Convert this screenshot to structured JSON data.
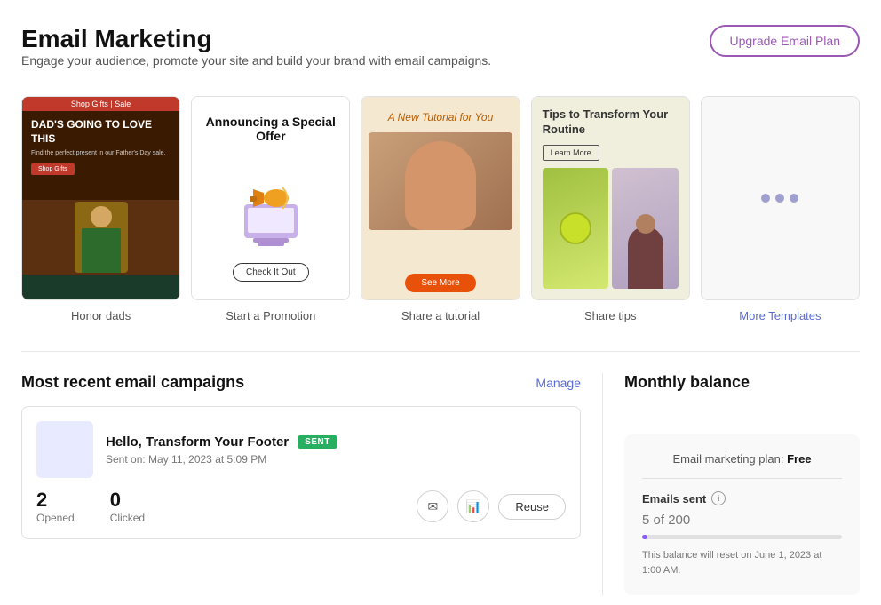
{
  "page": {
    "title": "Email Marketing",
    "subtitle": "Engage your audience, promote your site and build your brand with email campaigns."
  },
  "header": {
    "upgrade_label": "Upgrade Email Plan"
  },
  "templates": [
    {
      "id": "honor-dads",
      "label": "Honor dads",
      "top_bar": "Shop Gifts | Sale",
      "headline": "DAD'S GOING TO LOVE THIS",
      "body": "Find the perfect present in our Father's Day sale.",
      "cta": "Shop Gifts"
    },
    {
      "id": "start-promotion",
      "label": "Start a Promotion",
      "title": "Announcing a Special Offer",
      "cta": "Check It Out"
    },
    {
      "id": "share-tutorial",
      "label": "Share a tutorial",
      "title": "A New Tutorial for You",
      "cta": "See More"
    },
    {
      "id": "share-tips",
      "label": "Share tips",
      "title": "Tips to Transform Your Routine",
      "cta": "Learn More"
    },
    {
      "id": "more-templates",
      "label": "More Templates",
      "is_link": true
    }
  ],
  "campaigns": {
    "section_title": "Most recent email campaigns",
    "manage_label": "Manage",
    "items": [
      {
        "name": "Hello, Transform Your Footer",
        "status": "SENT",
        "date": "Sent on: May 11, 2023 at 5:09 PM",
        "opened": "2",
        "opened_label": "Opened",
        "clicked": "0",
        "clicked_label": "Clicked",
        "reuse_label": "Reuse"
      }
    ]
  },
  "balance": {
    "section_title": "Monthly balance",
    "plan_prefix": "Email marketing plan:",
    "plan_name": "Free",
    "emails_sent_label": "Emails sent",
    "count": "5",
    "total": "200",
    "count_display": "5 of 200",
    "progress_percent": 2.5,
    "reset_text": "This balance will reset on June 1, 2023 at 1:00 AM."
  },
  "icons": {
    "email": "✉",
    "chart": "📊",
    "info": "i"
  }
}
